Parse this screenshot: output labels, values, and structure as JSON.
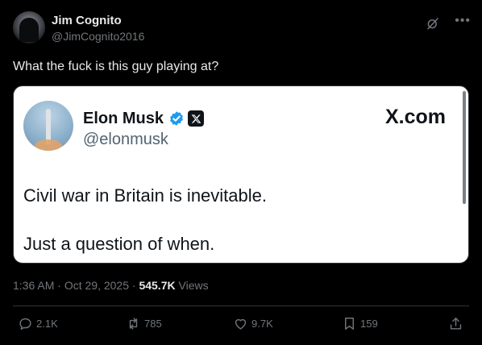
{
  "author": {
    "display_name": "Jim Cognito",
    "handle": "@JimCognito2016"
  },
  "tweet_text": "What the fuck is this guy playing at?",
  "quoted_card": {
    "name": "Elon Musk",
    "handle": "@elonmusk",
    "site": "X.com",
    "line1": "Civil war in Britain is inevitable.",
    "line2": "Just a question of when."
  },
  "meta": {
    "time": "1:36 AM",
    "date": "Oct 29, 2025",
    "separator": "·",
    "views_count": "545.7K",
    "views_label": "Views"
  },
  "actions": {
    "reply_count": "2.1K",
    "repost_count": "785",
    "like_count": "9.7K",
    "bookmark_count": "159"
  },
  "colors": {
    "background": "#000000",
    "text": "#e7e9ea",
    "muted": "#71767b",
    "verified": "#1d9bf0"
  }
}
